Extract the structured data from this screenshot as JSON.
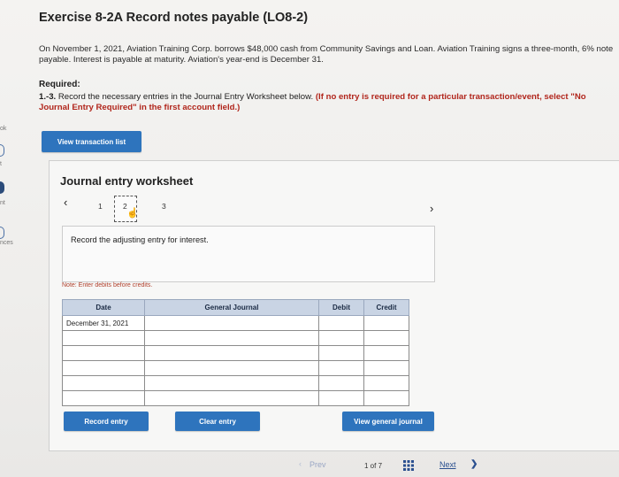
{
  "sidebar": {
    "fragments": [
      "ok",
      "t",
      "nt",
      "nces"
    ]
  },
  "exercise": {
    "title": "Exercise 8-2A Record notes payable (LO8-2)",
    "intro": "On November 1, 2021, Aviation Training Corp. borrows $48,000 cash from Community Savings and Loan. Aviation Training signs a three-month, 6% note payable. Interest is payable at maturity. Aviation's year-end is December 31.",
    "required_label": "Required:",
    "required_num": "1.-3.",
    "required_text": " Record the necessary entries in the Journal Entry Worksheet below. ",
    "required_note": "(If no entry is required for a particular transaction/event, select \"No Journal Entry Required\" in the first account field.)"
  },
  "buttons": {
    "view_transaction_list": "View transaction list",
    "record_entry": "Record entry",
    "clear_entry": "Clear entry",
    "view_general_journal": "View general journal"
  },
  "worksheet": {
    "title": "Journal entry worksheet",
    "pages": [
      "1",
      "2",
      "3"
    ],
    "current_page": 2,
    "description": "Record the adjusting entry for interest.",
    "note": "Note: Enter debits before credits.",
    "columns": {
      "date": "Date",
      "account": "General Journal",
      "debit": "Debit",
      "credit": "Credit"
    },
    "rows": [
      {
        "date": "December 31, 2021",
        "account": "",
        "debit": "",
        "credit": ""
      },
      {
        "date": "",
        "account": "",
        "debit": "",
        "credit": ""
      },
      {
        "date": "",
        "account": "",
        "debit": "",
        "credit": ""
      },
      {
        "date": "",
        "account": "",
        "debit": "",
        "credit": ""
      },
      {
        "date": "",
        "account": "",
        "debit": "",
        "credit": ""
      },
      {
        "date": "",
        "account": "",
        "debit": "",
        "credit": ""
      }
    ]
  },
  "footer": {
    "prev": "Prev",
    "page_of": "1 of 7",
    "next": "Next"
  },
  "icons": {
    "prev_arrow": "chevron-left-icon",
    "next_arrow": "chevron-right-icon",
    "grid": "grid-icon",
    "cursor": "hand-pointer-icon"
  },
  "colors": {
    "button_blue": "#2e74bd",
    "table_header": "#c9d4e4",
    "required_red": "#b1261c",
    "note_red": "#b0402c",
    "link_blue": "#2a4f8f"
  }
}
